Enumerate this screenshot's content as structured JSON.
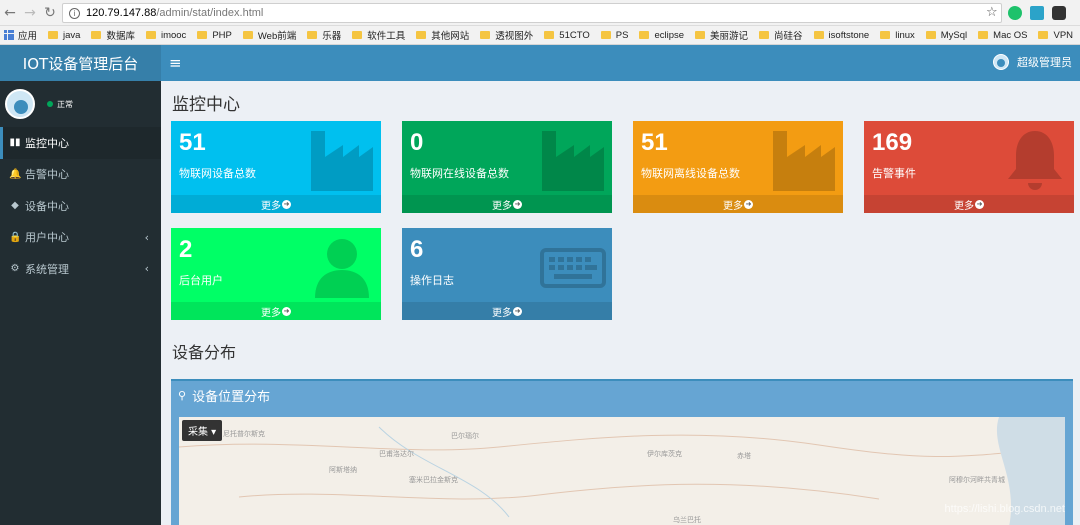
{
  "browser": {
    "address": {
      "host": "120.79.147.88",
      "path": "/admin/stat/index.html"
    },
    "bookmarks": [
      "应用",
      "java",
      "数据库",
      "imooc",
      "PHP",
      "Web前端",
      "乐器",
      "软件工具",
      "其他网站",
      "透视图外",
      "51CTO",
      "PS",
      "eclipse",
      "美丽游记",
      "尚硅谷",
      "isoftstone",
      "linux",
      "MySql",
      "Mac OS",
      "VPN"
    ]
  },
  "app": {
    "title": "IOT设备管理后台",
    "user_name": "超级管理员"
  },
  "sidebar": {
    "status": "正常",
    "items": [
      {
        "label": "监控中心",
        "icon": "bar-chart-icon",
        "glyph": "▮▮"
      },
      {
        "label": "告警中心",
        "icon": "bell-icon",
        "glyph": "🔔"
      },
      {
        "label": "设备中心",
        "icon": "cubes-icon",
        "glyph": "◆"
      },
      {
        "label": "用户中心",
        "icon": "lock-icon",
        "glyph": "🔒"
      },
      {
        "label": "系统管理",
        "icon": "gear-icon",
        "glyph": "⚙"
      }
    ],
    "caret": "‹"
  },
  "page": {
    "title": "监控中心",
    "section_title": "设备分布"
  },
  "boxes": [
    {
      "value": "51",
      "label": "物联网设备总数",
      "more": "更多",
      "color": "#00c0ef",
      "icon": "industry-icon"
    },
    {
      "value": "0",
      "label": "物联网在线设备总数",
      "more": "更多",
      "color": "#00a65a",
      "icon": "industry-icon"
    },
    {
      "value": "51",
      "label": "物联网离线设备总数",
      "more": "更多",
      "color": "#f39c12",
      "icon": "industry-icon"
    },
    {
      "value": "169",
      "label": "告警事件",
      "more": "更多",
      "color": "#dd4b39",
      "icon": "bell-icon"
    },
    {
      "value": "2",
      "label": "后台用户",
      "more": "更多",
      "color": "#00ff66",
      "icon": "user-icon"
    },
    {
      "value": "6",
      "label": "操作日志",
      "more": "更多",
      "color": "#3c8dbc",
      "icon": "keyboard-icon"
    }
  ],
  "map": {
    "title": "设备位置分布",
    "button": "采集",
    "labels": [
      "尼托普尔斯克",
      "巴尔瑙尔",
      "巴尔瑙尔",
      "巴甫洛达尔",
      "伊尔库茨克",
      "赤塔",
      "阿斯塔纳",
      "塞米巴拉金斯克",
      "乌兰巴托",
      "阿穆尔河畔共青城"
    ]
  },
  "watermark": "https://lishi.blog.csdn.net"
}
